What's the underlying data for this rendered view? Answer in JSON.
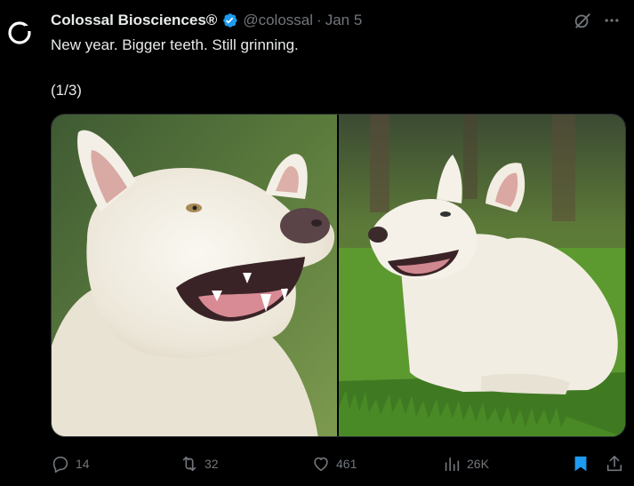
{
  "tweet": {
    "display_name": "Colossal Biosciences®",
    "handle": "@colossal",
    "separator": "·",
    "date": "Jan 5",
    "text_line1": "New year. Bigger teeth. Still grinning.",
    "text_line2": "(1/3)"
  },
  "media": {
    "images": [
      {
        "subject": "white wolf close-up with open mouth"
      },
      {
        "subject": "white wolf lying in grass"
      }
    ]
  },
  "actions": {
    "replies": "14",
    "reposts": "32",
    "likes": "461",
    "views": "26K"
  },
  "colors": {
    "background": "#000000",
    "text": "#e7e9ea",
    "muted": "#71767b",
    "verified": "#1d9bf0",
    "bookmark_active": "#1d9bf0"
  },
  "icons": [
    "avatar-logo",
    "verified-badge-icon",
    "grok-icon",
    "more-icon",
    "reply-icon",
    "repost-icon",
    "like-icon",
    "views-icon",
    "bookmark-icon",
    "share-icon"
  ]
}
